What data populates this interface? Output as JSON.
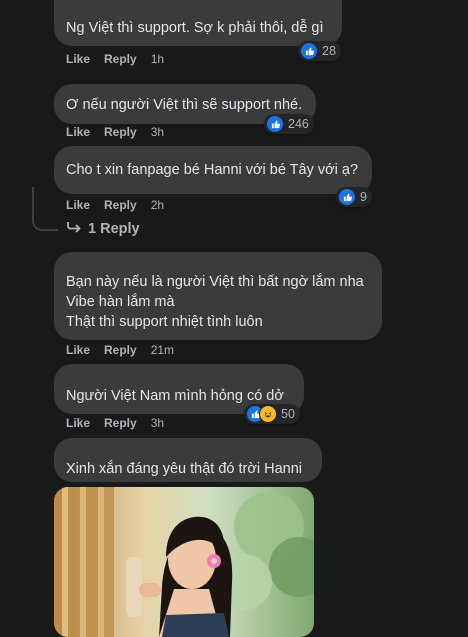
{
  "comments": [
    {
      "text": "Ng Việt thì support. Sợ k phải thôi, dễ gì",
      "like": "Like",
      "reply": "Reply",
      "time": "1h",
      "reactions": "28"
    },
    {
      "text": "Ơ nếu người Việt thì sẽ support nhé.",
      "like": "Like",
      "reply": "Reply",
      "time": "3h",
      "reactions": "246"
    },
    {
      "text": "Cho t xin fanpage bé Hanni với bé Tây với ạ?",
      "like": "Like",
      "reply": "Reply",
      "time": "2h",
      "reactions": "9"
    },
    {
      "lines": [
        "Bạn này nếu là người Việt thì bất ngờ lắm nha",
        "Vibe hàn lắm mà",
        "Thật thì support nhiệt tình luôn"
      ],
      "like": "Like",
      "reply": "Reply",
      "time": "21m"
    },
    {
      "text": "Người Việt Nam mình hỏng có dở",
      "like": "Like",
      "reply": "Reply",
      "time": "3h",
      "reactions": "50"
    },
    {
      "text": "Xinh xắn đáng yêu thật đó trời Hanni"
    }
  ],
  "view_replies": "1 Reply",
  "icons": {
    "like": "like-icon",
    "haha": "haha-icon",
    "reply_arrow": "reply-arrow-icon"
  },
  "colors": {
    "background": "#18191a",
    "bubble": "#3a3b3c",
    "like_blue": "#1b74e4",
    "haha_yellow": "#f7b928"
  }
}
